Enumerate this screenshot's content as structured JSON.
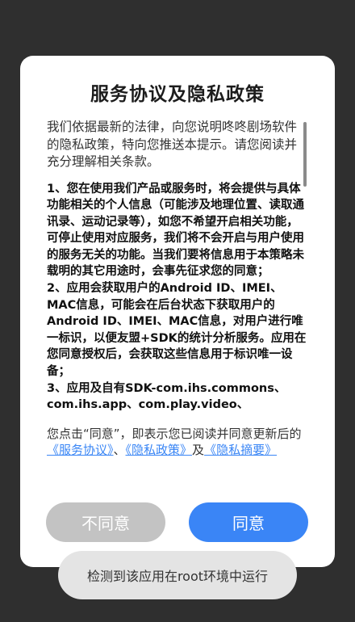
{
  "dialog": {
    "title": "服务协议及隐私政策",
    "intro": "我们依据最新的法律，向您说明咚咚剧场软件的隐私政策，特向您推送本提示。请您阅读并充分理解相关条款。",
    "terms": [
      "1、您在使用我们产品或服务时，将会提供与具体功能相关的个人信息（可能涉及地理位置、读取通讯录、运动记录等），如您不希望开启相关功能，可停止使用对应服务，我们将不会开启与用户使用的服务无关的功能。当我们要将信息用于本策略未载明的其它用途时，会事先征求您的同意；",
      "2、应用会获取用户的Android ID、IMEI、MAC信息，可能会在后台状态下获取用户的Android ID、IMEI、MAC信息，对用户进行唯一标识，以便友盟+SDK的统计分析服务。应用在您同意授权后，会获取这些信息用于标识唯一设备；",
      "3、应用及自有SDK-com.ihs.commons、com.ihs.app、com.play.video、"
    ],
    "consent": {
      "prefix": "您点击“同意”，即表示您已阅读并同意更新后的",
      "link_service": "《服务协议》",
      "separator": "、",
      "link_privacy": "《隐私政策》",
      "and": "及",
      "link_summary": "《隐私摘要》"
    },
    "disagree_label": "不同意",
    "agree_label": "同意"
  },
  "toast": {
    "text": "检测到该应用在root环境中运行"
  },
  "colors": {
    "accent": "#3a85f6",
    "disagree": "#c3c3c3",
    "backdrop": "#2f2f2f"
  }
}
